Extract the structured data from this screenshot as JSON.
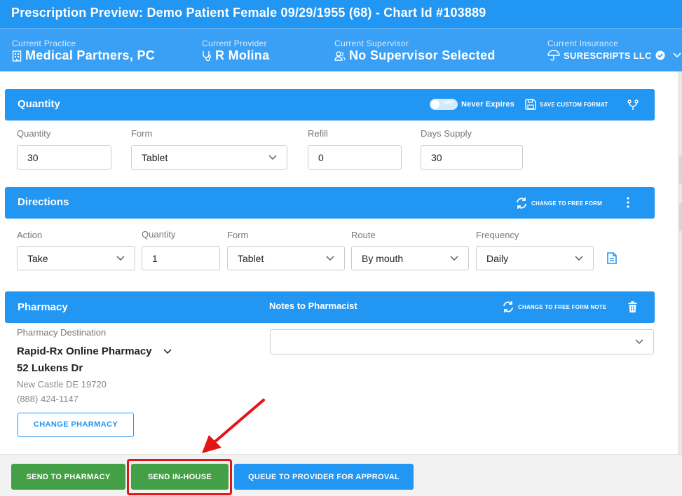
{
  "header": {
    "title": "Prescription Preview: Demo Patient Female 09/29/1955 (68) - Chart Id #103889"
  },
  "info": {
    "practice_label": "Current Practice",
    "practice_value": "Medical Partners, PC",
    "provider_label": "Current Provider",
    "provider_value": "R Molina",
    "supervisor_label": "Current Supervisor",
    "supervisor_value": "No Supervisor Selected",
    "insurance_label": "Current Insurance",
    "insurance_value": "SURESCRIPTS LLC"
  },
  "quantity_section": {
    "title": "Quantity",
    "toggle_text": "OFF",
    "never_expires": "Never Expires",
    "save_format": "SAVE CUSTOM FORMAT",
    "fields": {
      "quantity_label": "Quantity",
      "quantity_value": "30",
      "form_label": "Form",
      "form_value": "Tablet",
      "refill_label": "Refill",
      "refill_value": "0",
      "days_label": "Days Supply",
      "days_value": "30"
    }
  },
  "directions_section": {
    "title": "Directions",
    "change_free_form": "CHANGE TO FREE FORM",
    "fields": {
      "action_label": "Action",
      "action_value": "Take",
      "quantity_label": "Quantity",
      "quantity_value": "1",
      "form_label": "Form",
      "form_value": "Tablet",
      "route_label": "Route",
      "route_value": "By mouth",
      "frequency_label": "Frequency",
      "frequency_value": "Daily"
    }
  },
  "pharmacy_section": {
    "title": "Pharmacy",
    "notes_title": "Notes to Pharmacist",
    "change_free_form_note": "CHANGE TO FREE FORM NOTE",
    "destination_label": "Pharmacy Destination",
    "pharmacy_name": "Rapid-Rx Online Pharmacy",
    "address": "52 Lukens Dr",
    "city": "New Castle DE 19720",
    "phone": "(888) 424-1147",
    "change_button": "CHANGE PHARMACY"
  },
  "footer": {
    "send_pharmacy": "SEND TO PHARMACY",
    "send_inhouse": "SEND IN-HOUSE",
    "queue_approval": "QUEUE TO PROVIDER FOR APPROVAL"
  },
  "colors": {
    "primary": "#2196f3",
    "success": "#43a047",
    "highlight": "#e31515"
  }
}
